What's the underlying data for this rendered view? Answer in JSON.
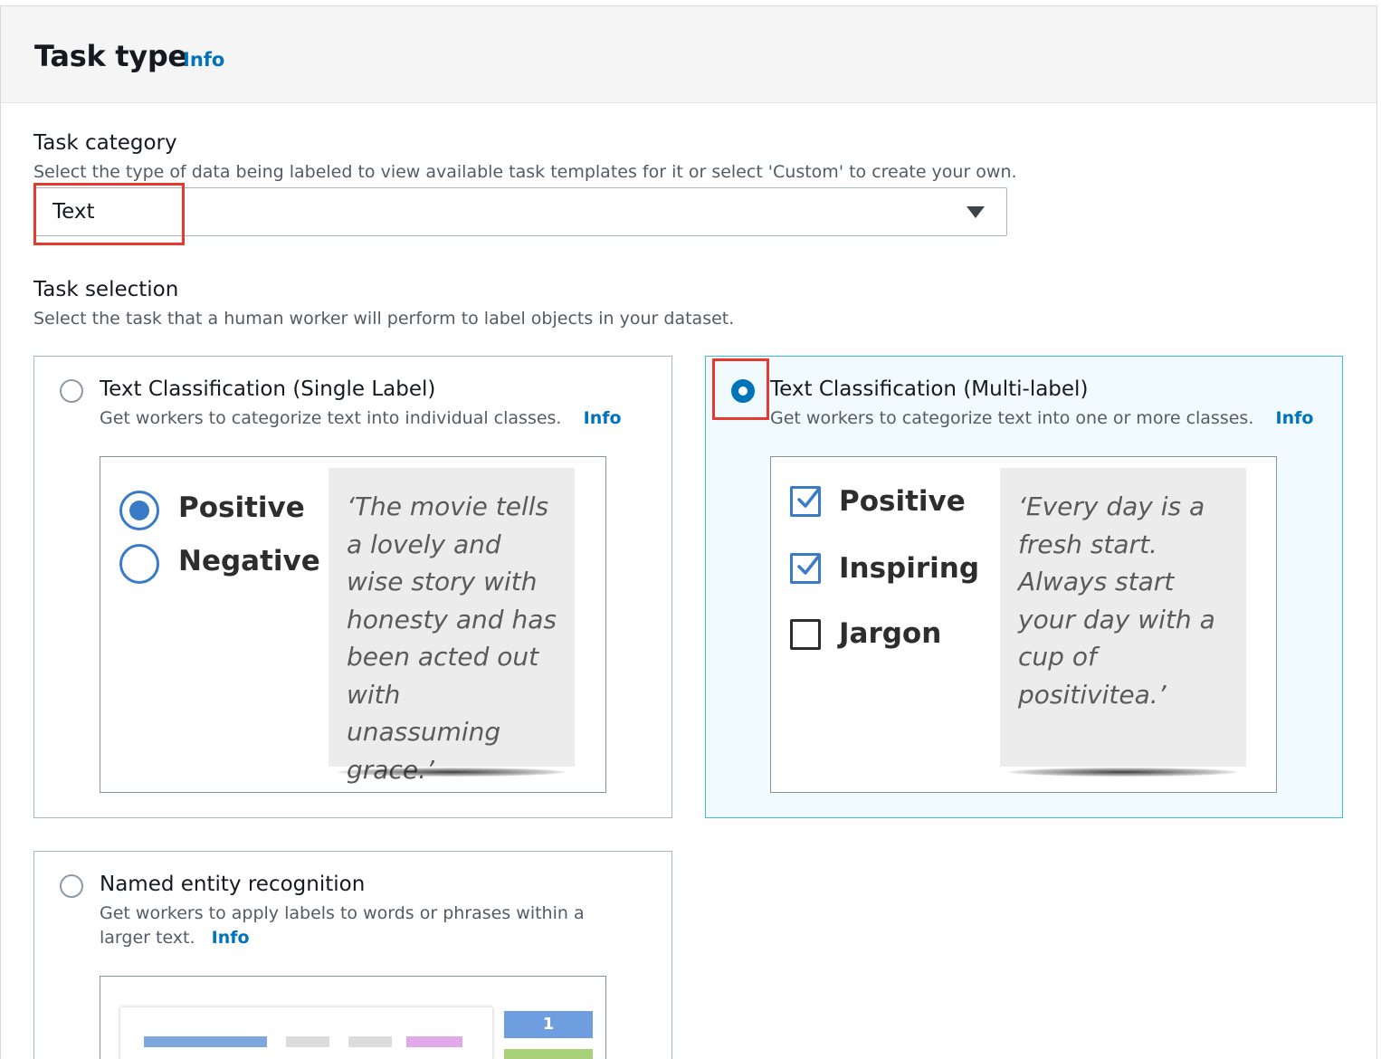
{
  "header": {
    "title": "Task type",
    "info": "Info"
  },
  "category": {
    "label": "Task category",
    "description": "Select the type of data being labeled to view available task templates for it or select 'Custom' to create your own.",
    "selected": "Text"
  },
  "selection": {
    "label": "Task selection",
    "description": "Select the task that a human worker will perform to label objects in your dataset."
  },
  "cards": {
    "single": {
      "title": "Text Classification (Single Label)",
      "description": "Get workers to categorize text into individual classes.",
      "info": "Info",
      "preview": {
        "options": [
          "Positive",
          "Negative"
        ],
        "quote": "‘The movie tells a lovely and wise story with honesty and has been acted out with unassuming grace.’"
      }
    },
    "multi": {
      "title": "Text Classification (Multi-label)",
      "description": "Get workers to categorize text into one or more classes.",
      "info": "Info",
      "preview": {
        "options": [
          "Positive",
          "Inspiring",
          "Jargon"
        ],
        "checked": [
          true,
          true,
          false
        ],
        "quote": "‘Every day is a fresh start. Always start your day with a cup of positivitea.’"
      }
    },
    "ner": {
      "title": "Named entity recognition",
      "description": "Get workers to apply labels to words or phrases within a larger text.",
      "info": "Info",
      "preview": {
        "badges": [
          "1"
        ]
      }
    }
  },
  "colors": {
    "accent": "#0073bb",
    "highlight": "#e53a2d",
    "selected_bg": "#f1faff"
  }
}
